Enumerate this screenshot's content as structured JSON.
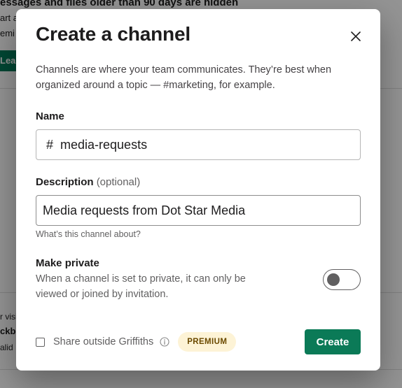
{
  "background": {
    "top_text": "essages and files older than 90 days are hidden",
    "line1": "art a",
    "line2": "emi",
    "button_label": "Lea",
    "lower_line1": "r visi",
    "lower_line2": "ckbo",
    "lower_line3": "alid"
  },
  "modal": {
    "title": "Create a channel",
    "intro": "Channels are where your team communicates. They’re best when organized around a topic — #marketing, for example.",
    "name": {
      "label": "Name",
      "prefix": "#",
      "value": "media-requests"
    },
    "description": {
      "label": "Description",
      "optional": "(optional)",
      "value": "Media requests from Dot Star Media",
      "hint": "What’s this channel about?"
    },
    "private": {
      "label": "Make private",
      "description": "When a channel is set to private, it can only be viewed or joined by invitation.",
      "enabled": false
    },
    "share": {
      "label": "Share outside Griffiths",
      "checked": false,
      "badge": "PREMIUM"
    },
    "create_label": "Create"
  },
  "colors": {
    "primary_button": "#0b7a57",
    "badge_bg": "#fdf3d6",
    "badge_text": "#6b4a00"
  },
  "icons": {
    "close": "close-icon",
    "info": "info-icon"
  }
}
